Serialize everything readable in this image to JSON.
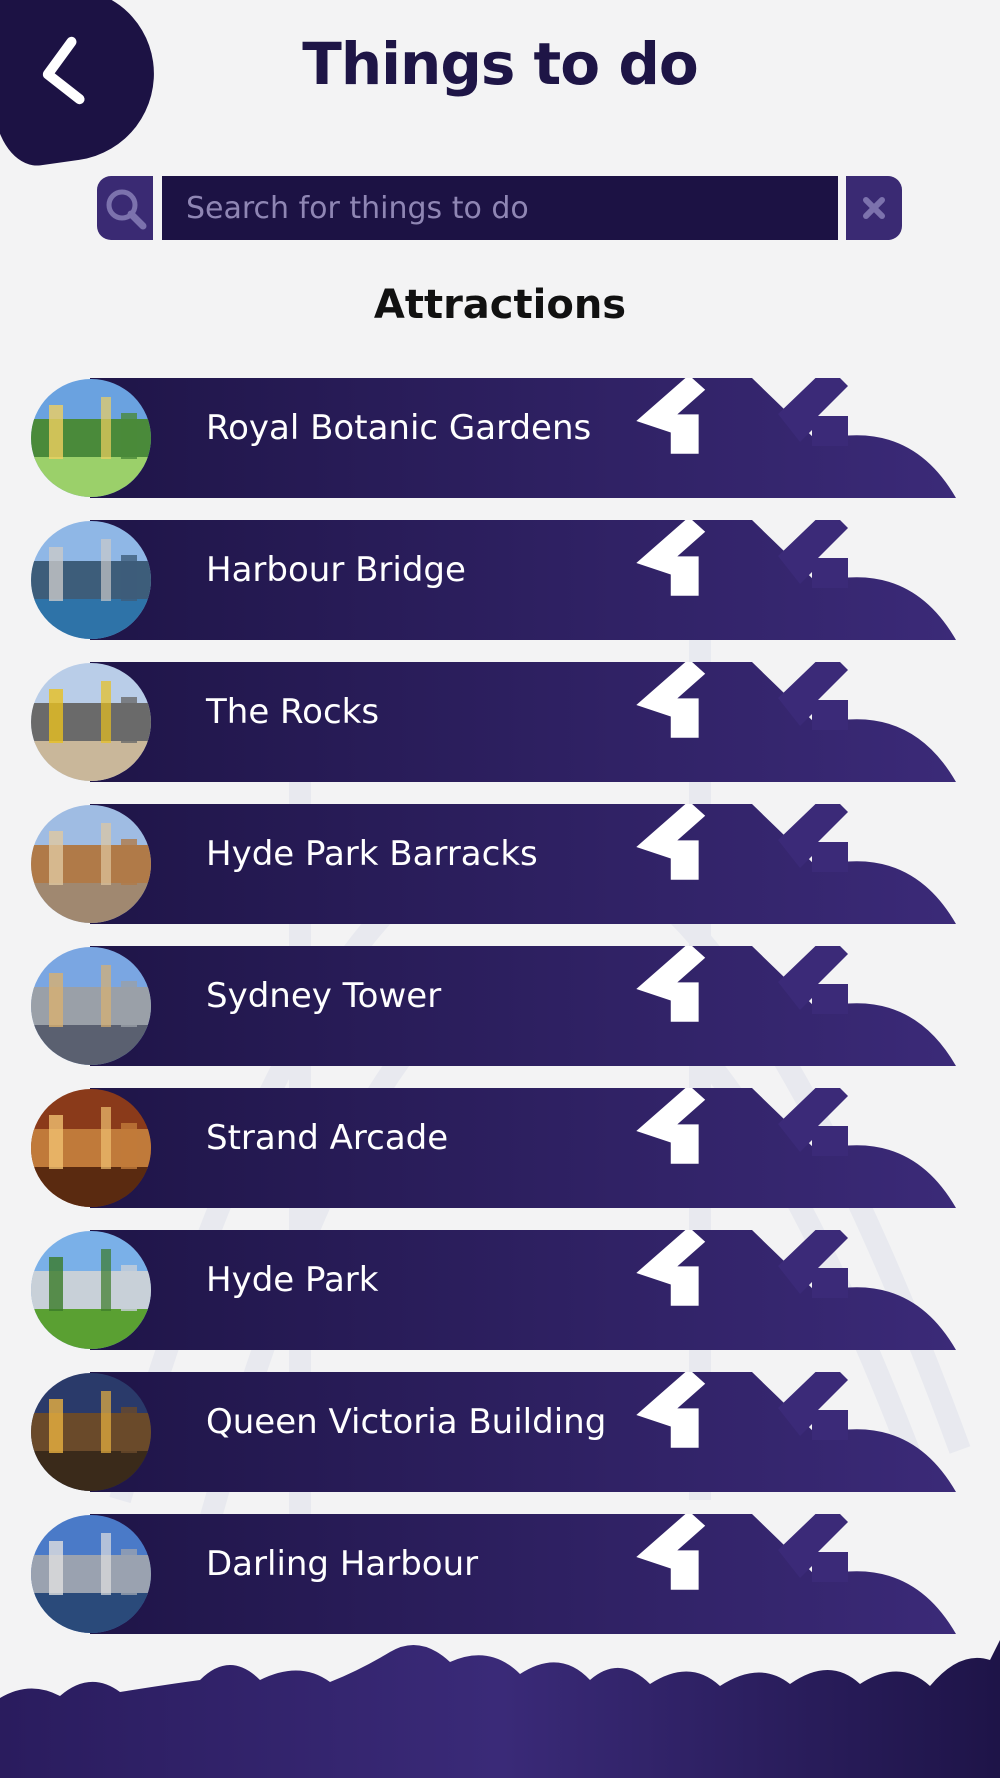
{
  "header": {
    "title": "Things to do",
    "back_label": "Back"
  },
  "search": {
    "placeholder": "Search for things to do",
    "value": ""
  },
  "section": {
    "title": "Attractions"
  },
  "attractions": [
    {
      "name": "Royal Botanic Gardens",
      "photo": "gardens"
    },
    {
      "name": "Harbour Bridge",
      "photo": "bridge"
    },
    {
      "name": "The Rocks",
      "photo": "rocks"
    },
    {
      "name": "Hyde Park Barracks",
      "photo": "barracks"
    },
    {
      "name": "Sydney Tower",
      "photo": "tower"
    },
    {
      "name": "Strand Arcade",
      "photo": "arcade"
    },
    {
      "name": "Hyde Park",
      "photo": "park"
    },
    {
      "name": "Queen Victoria Building",
      "photo": "qvb"
    },
    {
      "name": "Darling Harbour",
      "photo": "harbour"
    }
  ],
  "colors": {
    "background": "#f3f3f4",
    "navy": "#1c1244",
    "purple": "#3a2a73",
    "banner_start": "#1f1548",
    "banner_end": "#3b2a78",
    "title": "#1e1546"
  },
  "icons": {
    "back": "chevron-left-icon",
    "search": "magnifier-icon",
    "clear": "close-icon",
    "row_badge": "bookmark-icon"
  }
}
